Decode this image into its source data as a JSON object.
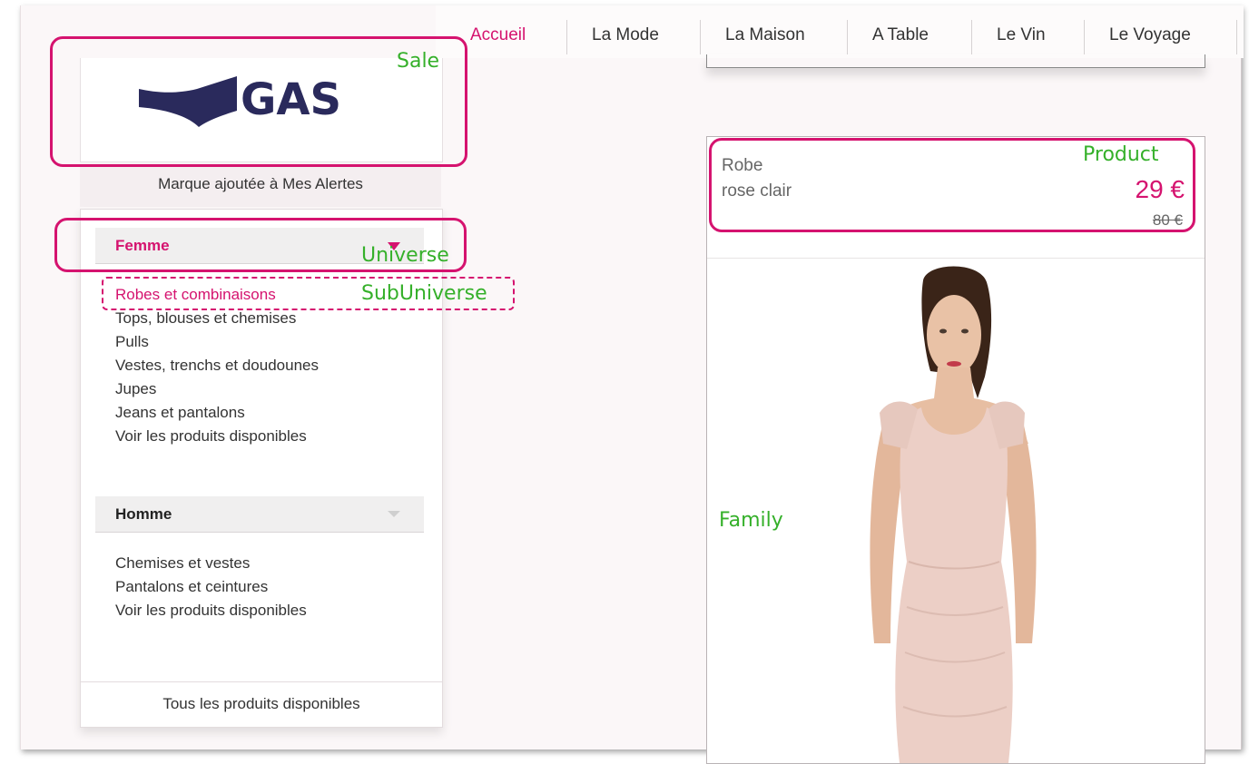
{
  "nav": {
    "items": [
      {
        "label": "Accueil",
        "active": true
      },
      {
        "label": "La Mode",
        "active": false
      },
      {
        "label": "La Maison",
        "active": false
      },
      {
        "label": "A Table",
        "active": false
      },
      {
        "label": "Le Vin",
        "active": false
      },
      {
        "label": "Le Voyage",
        "active": false
      }
    ]
  },
  "brand": {
    "logo_text": "GAS",
    "alert_text": "Marque ajoutée à Mes Alertes"
  },
  "sidebar": {
    "universes": [
      {
        "label": "Femme",
        "active": true,
        "items": [
          {
            "label": "Robes et combinaisons",
            "active": true
          },
          {
            "label": "Tops, blouses et chemises",
            "active": false
          },
          {
            "label": "Pulls",
            "active": false
          },
          {
            "label": "Vestes, trenchs et doudounes",
            "active": false
          },
          {
            "label": "Jupes",
            "active": false
          },
          {
            "label": "Jeans et pantalons",
            "active": false
          },
          {
            "label": "Voir les produits disponibles",
            "active": false
          }
        ]
      },
      {
        "label": "Homme",
        "active": false,
        "items": [
          {
            "label": "Chemises et vestes",
            "active": false
          },
          {
            "label": "Pantalons et ceintures",
            "active": false
          },
          {
            "label": "Voir les produits disponibles",
            "active": false
          }
        ]
      }
    ],
    "footer": "Tous les produits disponibles"
  },
  "product": {
    "name_line1": "Robe",
    "name_line2": "rose clair",
    "price": "29 €",
    "old_price": "80 €"
  },
  "annotations": {
    "sale": "Sale",
    "product": "Product",
    "universe": "Universe",
    "subuniverse": "SubUniverse",
    "family": "Family"
  },
  "colors": {
    "accent": "#d5136f",
    "annotation_label": "#35b02a",
    "brand_navy": "#2a2a5c"
  }
}
